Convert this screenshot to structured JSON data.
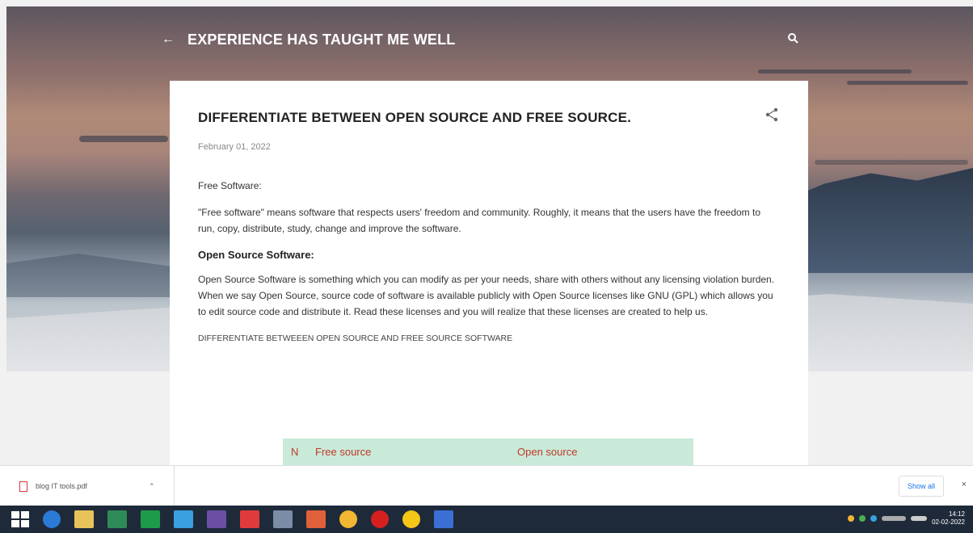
{
  "header": {
    "blog_title": "EXPERIENCE HAS TAUGHT ME WELL"
  },
  "post": {
    "title": "DIFFERENTIATE BETWEEN OPEN SOURCE AND FREE SOURCE.",
    "date": "February 01, 2022",
    "free_software_heading": "Free Software:",
    "free_software_text": "\"Free software\" means software that respects users' freedom and community. Roughly, it means that the users have the freedom to run, copy, distribute, study, change and improve the software.",
    "open_source_heading": "Open Source Software:",
    "open_source_text": "Open Source Software is something which you can modify as per your needs, share with others without any licensing violation burden. When we say Open Source, source code of software is available publicly with Open Source licenses like GNU (GPL) which allows you to edit source code and distribute it. Read these licenses and you will realize that these licenses are created to help us.",
    "table_caption": "DIFFERENTIATE BETWEEEN OPEN SOURCE AND FREE SOURCE SOFTWARE",
    "table_headers": [
      "N",
      "Free source",
      "Open source"
    ]
  },
  "downloads": {
    "file_name": "blog IT tools.pdf",
    "show_all": "Show all",
    "close": "×"
  },
  "taskbar": {
    "time": "14:12",
    "date": "02-02-2022"
  },
  "colors": {
    "table_header_bg": "#c9ead8",
    "table_header_text": "#c0392b",
    "link_blue": "#1a73e8"
  }
}
